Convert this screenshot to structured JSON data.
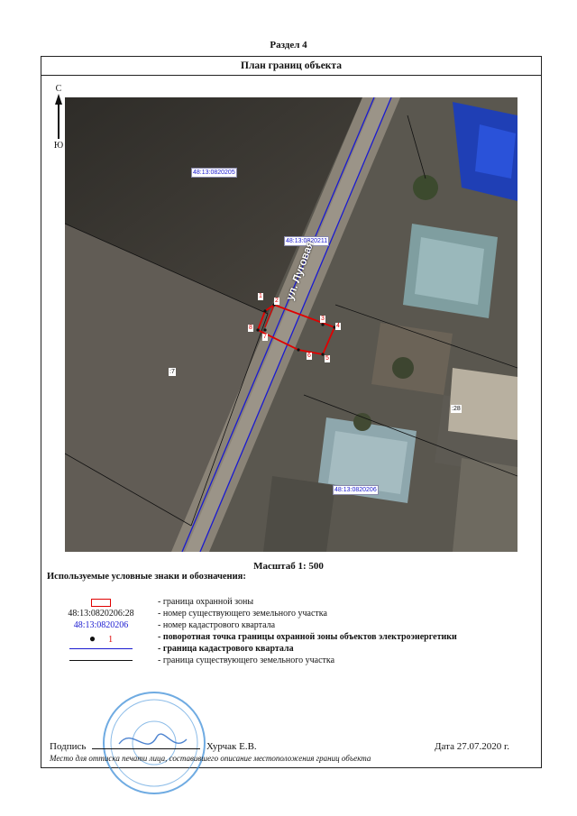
{
  "section": "Раздел 4",
  "title": "План границ объекта",
  "north": {
    "top": "С",
    "bottom": "Ю"
  },
  "map": {
    "quarter_labels": [
      "48:13:0820205",
      "48:13:0820211",
      "48:13:0820206"
    ],
    "parcel_labels": [
      ":7",
      ":28"
    ],
    "street": "ул. Луговая",
    "points": [
      "1",
      "2",
      "3",
      "4",
      "5",
      "6",
      "7",
      "8"
    ]
  },
  "scale": "Масштаб 1: 500",
  "legend": {
    "heading": "Используемые условные знаки и обозначения:",
    "items": [
      {
        "symbol": "",
        "text": "- граница  охранной зоны"
      },
      {
        "symbol": "48:13:0820206:28",
        "text": "- номер существующего земельного участка"
      },
      {
        "symbol": "48:13:0820206",
        "text": "- номер кадастрового квартала"
      },
      {
        "symbol": "1",
        "text": "- поворотная точка границы охранной зоны объектов электроэнергетики"
      },
      {
        "symbol": "",
        "text": "- граница кадастрового квартала"
      },
      {
        "symbol": "",
        "text": "- граница существующего земельного участка"
      }
    ]
  },
  "signature": {
    "label": "Подпись",
    "name": "Хурчак Е.В.",
    "date": "Дата 27.07.2020 г."
  },
  "note": "Место для оттиска печати лица, составившего описание местоположения границ объекта",
  "colors": {
    "zone": "#e00000",
    "quarter": "#1a1ad0",
    "parcel": "#111111"
  }
}
